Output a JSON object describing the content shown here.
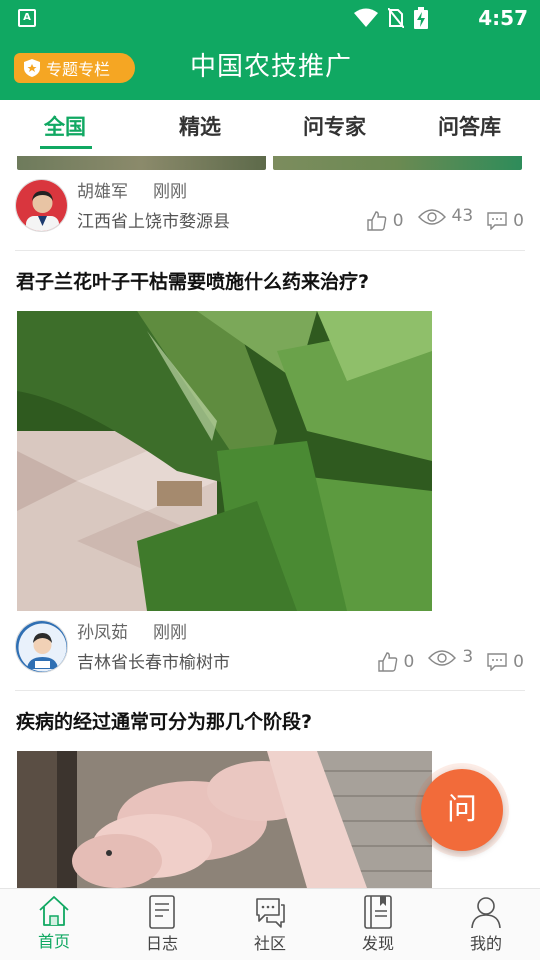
{
  "status_bar": {
    "time": "4:57",
    "left_icon": "A"
  },
  "header": {
    "badge_label": "专题专栏",
    "title": "中国农技推广"
  },
  "tabs": [
    {
      "label": "全国",
      "active": true
    },
    {
      "label": "精选",
      "active": false
    },
    {
      "label": "问专家",
      "active": false
    },
    {
      "label": "问答库",
      "active": false
    }
  ],
  "posts": [
    {
      "author": "胡雄军",
      "time": "刚刚",
      "location": "江西省上饶市婺源县",
      "likes": "0",
      "views": "43",
      "comments": "0"
    },
    {
      "title": "君子兰花叶子干枯需要喷施什么药来治疗?",
      "author": "孙凤茹",
      "time": "刚刚",
      "location": "吉林省长春市榆树市",
      "likes": "0",
      "views": "3",
      "comments": "0"
    },
    {
      "title": "疾病的经过通常可分为那几个阶段?"
    }
  ],
  "fab": {
    "label": "问"
  },
  "bottom_nav": [
    {
      "label": "首页",
      "icon": "home-icon",
      "active": true
    },
    {
      "label": "日志",
      "icon": "journal-icon",
      "active": false
    },
    {
      "label": "社区",
      "icon": "chat-bubbles-icon",
      "active": false
    },
    {
      "label": "发现",
      "icon": "book-icon",
      "active": false
    },
    {
      "label": "我的",
      "icon": "user-icon",
      "active": false
    }
  ],
  "colors": {
    "brand_green": "#10a862",
    "badge_orange": "#f5a623",
    "fab_orange": "#f26b3a"
  }
}
